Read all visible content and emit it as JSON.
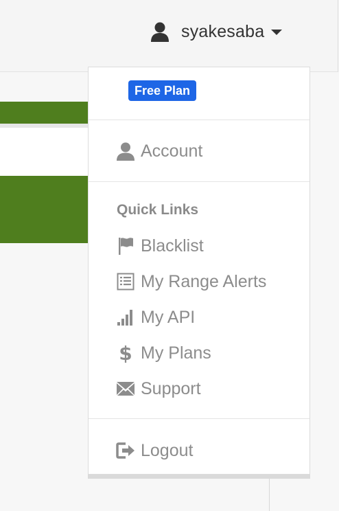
{
  "navbar": {
    "username": "syakesaba"
  },
  "dropdown": {
    "plan_badge": "Free Plan",
    "account_label": "Account",
    "quick_links_header": "Quick Links",
    "quick_links": [
      {
        "label": "Blacklist",
        "icon": "flag-icon"
      },
      {
        "label": "My Range Alerts",
        "icon": "list-icon"
      },
      {
        "label": "My API",
        "icon": "signal-bars-icon"
      },
      {
        "label": "My Plans",
        "icon": "dollar-icon"
      },
      {
        "label": "Support",
        "icon": "envelope-icon"
      }
    ],
    "logout_label": "Logout"
  },
  "colors": {
    "badge": "#1e66e6",
    "green_bar": "#4f7e1e",
    "menu_text": "#8c8c8c"
  }
}
